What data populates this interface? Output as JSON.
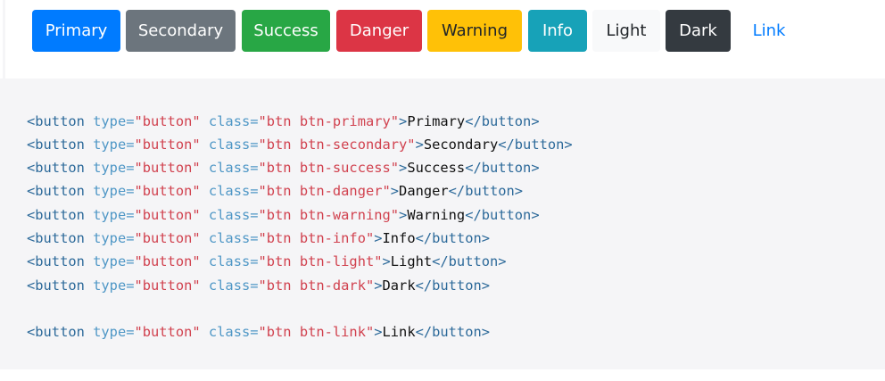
{
  "buttons": [
    {
      "label": "Primary",
      "bg": "#007bff",
      "fg": "#ffffff"
    },
    {
      "label": "Secondary",
      "bg": "#6c757d",
      "fg": "#ffffff"
    },
    {
      "label": "Success",
      "bg": "#28a745",
      "fg": "#ffffff"
    },
    {
      "label": "Danger",
      "bg": "#dc3545",
      "fg": "#ffffff"
    },
    {
      "label": "Warning",
      "bg": "#ffc107",
      "fg": "#212529"
    },
    {
      "label": "Info",
      "bg": "#17a2b8",
      "fg": "#ffffff"
    },
    {
      "label": "Light",
      "bg": "#f8f9fa",
      "fg": "#212529"
    },
    {
      "label": "Dark",
      "bg": "#343a40",
      "fg": "#ffffff"
    },
    {
      "label": "Link",
      "bg": "transparent",
      "fg": "#007bff"
    }
  ],
  "code": {
    "lines": [
      {
        "cls": "btn btn-primary",
        "text": "Primary"
      },
      {
        "cls": "btn btn-secondary",
        "text": "Secondary"
      },
      {
        "cls": "btn btn-success",
        "text": "Success"
      },
      {
        "cls": "btn btn-danger",
        "text": "Danger"
      },
      {
        "cls": "btn btn-warning",
        "text": "Warning"
      },
      {
        "cls": "btn btn-info",
        "text": "Info"
      },
      {
        "cls": "btn btn-light",
        "text": "Light"
      },
      {
        "cls": "btn btn-dark",
        "text": "Dark"
      },
      {
        "cls": "btn btn-link",
        "text": "Link"
      }
    ],
    "open_tag": "<button",
    "type_attr": " type=",
    "type_val": "\"button\"",
    "class_attr": " class=",
    "close_open": ">",
    "close_tag": "</button>"
  }
}
